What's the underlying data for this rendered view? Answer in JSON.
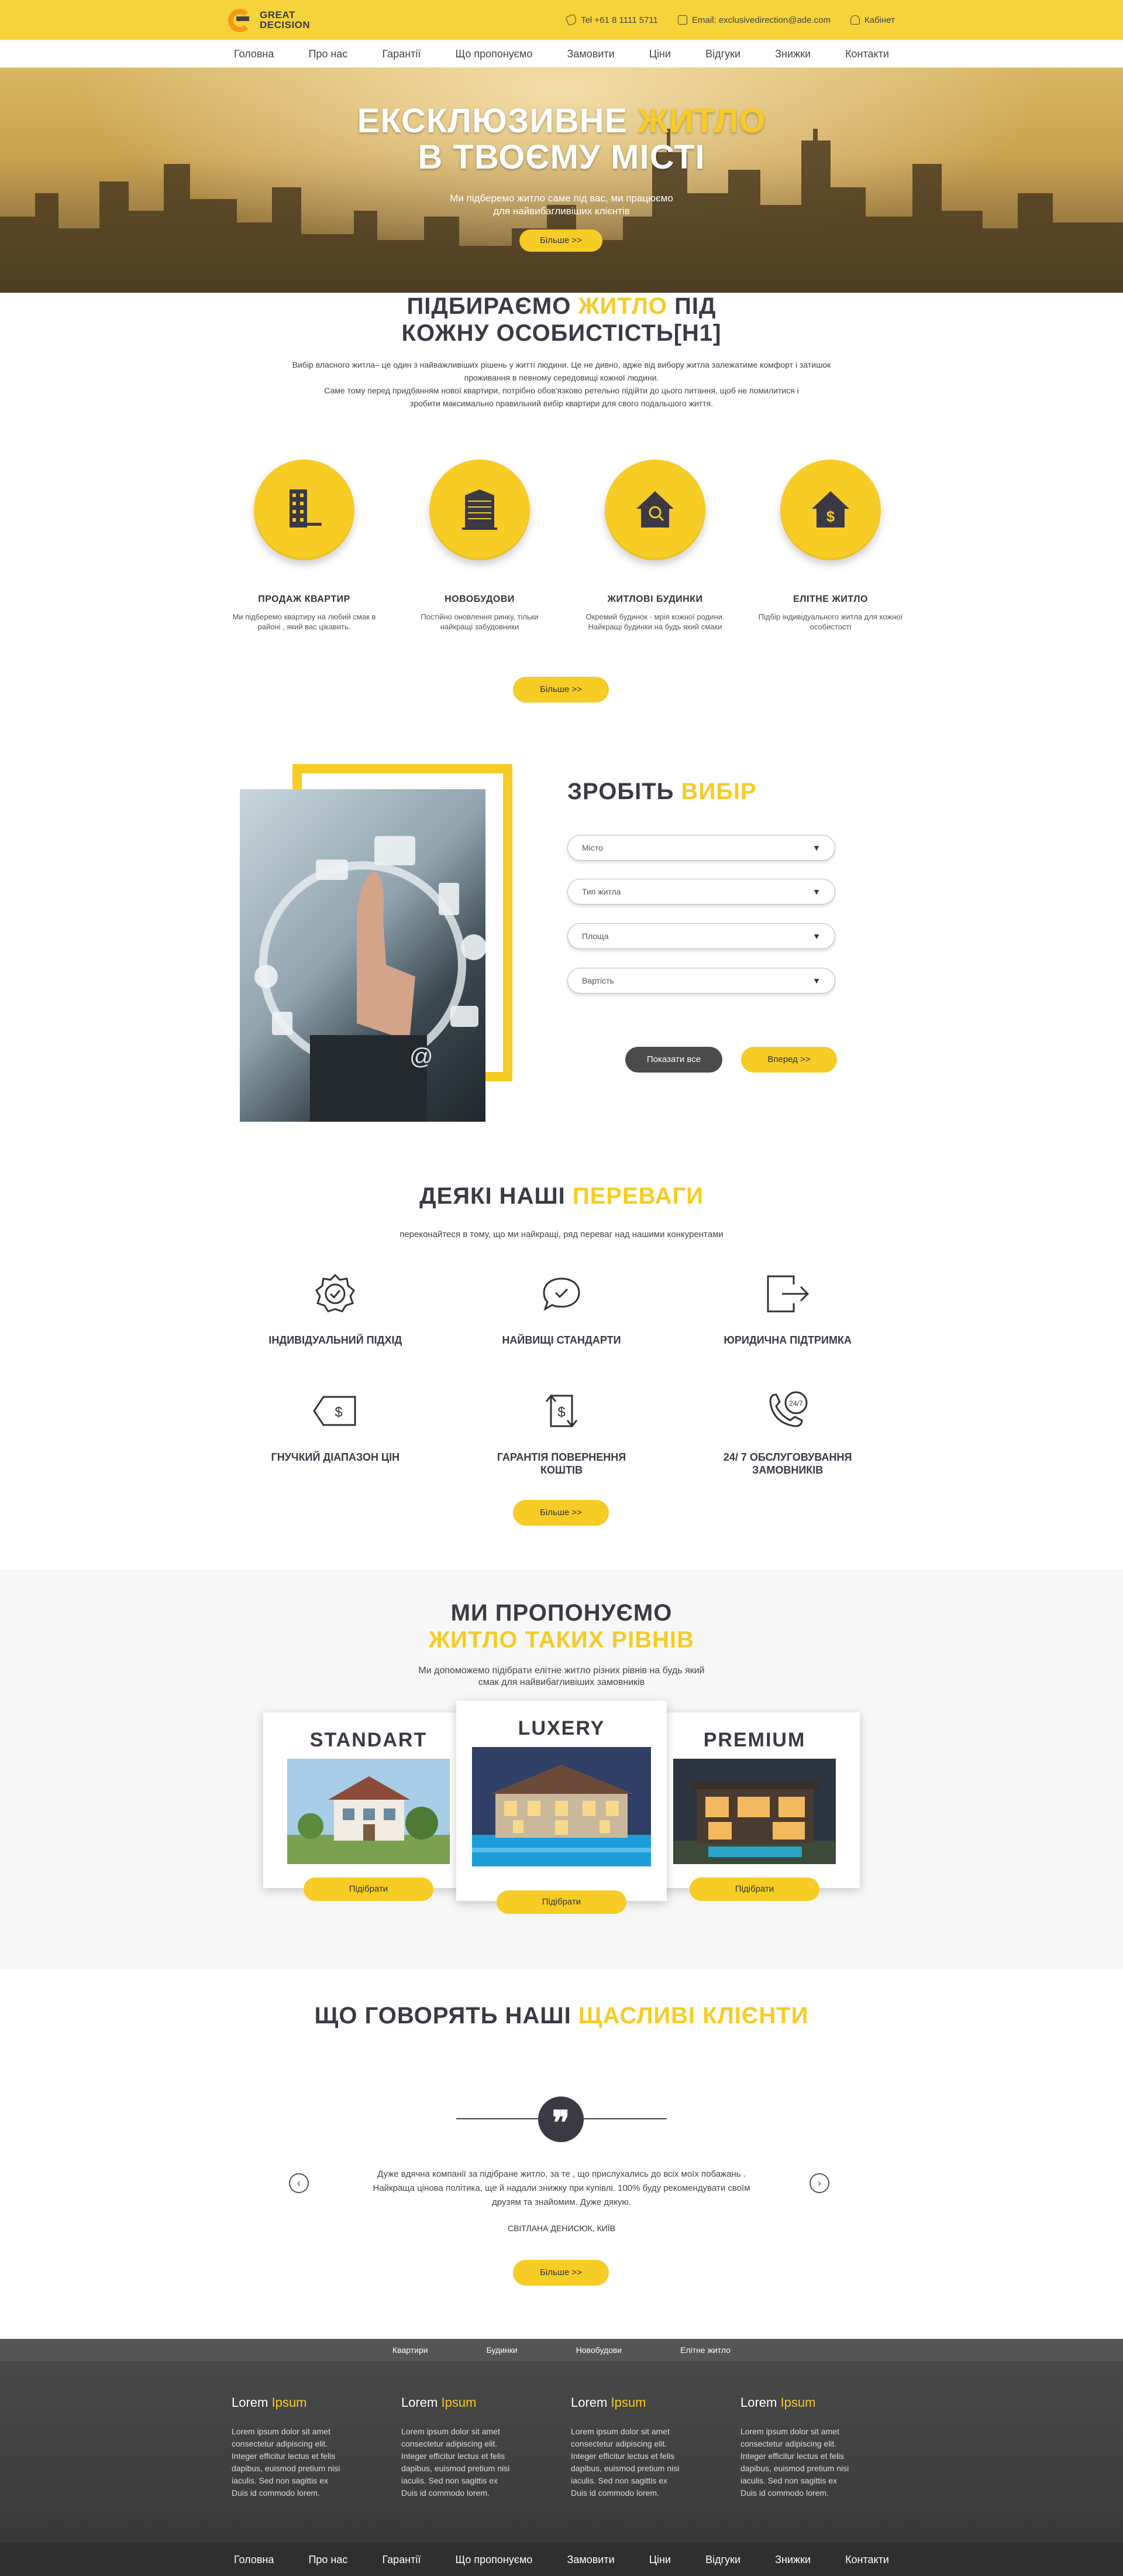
{
  "brand": {
    "logo_line1": "GREAT",
    "logo_line2": "DECISION"
  },
  "header": {
    "phone": "Tel +61 8 1111 5711",
    "email": "Email: exclusivedirection@ade.com",
    "cabinet": "Кабінет"
  },
  "nav": [
    "Головна",
    "Про нас",
    "Гарантії",
    "Що пропонуємо",
    "Замовити",
    "Ціни",
    "Відгуки",
    "Знижки",
    "Контакти"
  ],
  "hero": {
    "title_part1": "ЕКСКЛЮЗИВНЕ ",
    "title_accent": "ЖИТЛО",
    "title_line2": "В ТВОЄМУ МІСТІ",
    "subtitle_line1": "Ми підберемо житло саме під вас, ми працюємо",
    "subtitle_line2": "для найвибагливіших клієнтів",
    "button": "Більше >>"
  },
  "section_pick": {
    "title_part1": "ПІДБИРАЄМО ",
    "title_accent": "ЖИТЛО",
    "title_part2": " ПІД",
    "title_line2": "КОЖНУ ОСОБИСТІСТЬ[H1]",
    "intro_line1": "Вибір власного житла– це один з найважливіших рішень у житті людини. Це не дивно, адже від вибору житла залежатиме комфорт і затишок",
    "intro_line2": "проживання в певному середовищі кожної людини.",
    "intro_line3": "Саме тому перед придбанням нової квартири, потрібно обов'язково ретельно підійти до цього питання, щоб не помилитися і",
    "intro_line4": "зробити максимально правильний вибір квартири для свого подальшого життя.",
    "categories": [
      {
        "title": "ПРОДАЖ КВАРТИР",
        "text": "Ми підберемо квартиру на любий смак в районі , який вас цікавить.",
        "icon": "apartment-building-icon"
      },
      {
        "title": "НОВОБУДОВИ",
        "text": "Постійно оновлення ринку, тільки найкращі забудовники",
        "icon": "new-building-icon"
      },
      {
        "title": "ЖИТЛОВІ БУДИНКИ",
        "text": "Окремий будинок - мрія кожної родини. Найкращі будинки на будь який смаки",
        "icon": "house-search-icon"
      },
      {
        "title": "ЕЛІТНЕ ЖИТЛО",
        "text": "Підбір індивідуального житла для кожної особистості",
        "icon": "house-dollar-icon"
      }
    ],
    "button": "Більше >>"
  },
  "choice": {
    "title_part1": "ЗРОБІТЬ ",
    "title_accent": "ВИБІР",
    "selects": [
      "Місто",
      "Тип житла",
      "Площа",
      "Вартість"
    ],
    "show_all": "Показати все",
    "next": "Вперед >>"
  },
  "advantages": {
    "title_part1": "ДЕЯКІ НАШІ ",
    "title_accent": "ПЕРЕВАГИ",
    "subtitle": "переконайтеся в тому, що ми найкращі, ряд переваг над нашими конкурентами",
    "items": [
      {
        "title": "ІНДИВІДУАЛЬНИЙ ПІДХІД",
        "icon": "badge-check-icon"
      },
      {
        "title": "НАЙВИЩІ СТАНДАРТИ",
        "icon": "chat-check-icon"
      },
      {
        "title": "ЮРИДИЧНА ПІДТРИМКА",
        "icon": "exit-arrow-icon"
      },
      {
        "title": "ГНУЧКИЙ ДІАПАЗОН ЦІН",
        "icon": "price-tag-icon"
      },
      {
        "title_line1": "ГАРАНТІЯ ПОВЕРНЕННЯ",
        "title_line2": "КОШТІВ",
        "icon": "money-return-icon"
      },
      {
        "title_line1": "24/ 7 ОБСЛУГОВУВАННЯ",
        "title_line2": "ЗАМОВНИКІВ",
        "icon": "phone-24-7-icon"
      }
    ],
    "button": "Більше >>"
  },
  "levels": {
    "title_line1": "МИ ПРОПОНУЄМО",
    "title_line2": "ЖИТЛО ТАКИХ РІВНІВ",
    "subtitle_line1": "Ми допоможемо підібрати елітне житло різних рівнів на будь який",
    "subtitle_line2": "смак для найвибагливіших замовників",
    "cards": [
      {
        "title": "STANDART",
        "button": "Підібрати"
      },
      {
        "title": "LUXERY",
        "button": "Підібрати"
      },
      {
        "title": "PREMIUM",
        "button": "Підібрати"
      }
    ]
  },
  "testimonials": {
    "title_part1": "ЩО ГОВОРЯТЬ НАШІ ",
    "title_accent": "ЩАСЛИВІ КЛІЄНТИ",
    "quote_mark": "❞",
    "text_line1": "Дуже вдячна компанії за підібране житло, за те , що прислухались до всіх моїх побажань .",
    "text_line2": "Найкраща цінова політика, ще й надали  знижку при купівлі. 100% буду рекомендувати своїм",
    "text_line3": "друзям та знайомим. Дуже дякую.",
    "author": "СВІТЛАНА ДЕНИСЮК, КИЇВ",
    "prev": "‹",
    "next": "›",
    "button": "Більше >>"
  },
  "footer": {
    "categories": [
      "Квартири",
      "Будинки",
      "Новобудови",
      "Елітне житло"
    ],
    "columns": [
      {
        "title_part1": "Lorem ",
        "title_accent": "Ipsum",
        "text": "Lorem ipsum dolor sit amet consectetur adipiscing elit. Integer efficitur lectus et felis dapibus, euismod pretium nisi iaculis. Sed non sagittis ex Duis id commodo lorem."
      },
      {
        "title_part1": "Lorem ",
        "title_accent": "Ipsum",
        "text": "Lorem ipsum dolor sit amet consectetur adipiscing elit. Integer efficitur lectus et felis dapibus, euismod pretium nisi iaculis. Sed non sagittis ex Duis id commodo lorem."
      },
      {
        "title_part1": "Lorem ",
        "title_accent": "Ipsum",
        "text": "Lorem ipsum dolor sit amet consectetur adipiscing elit. Integer efficitur lectus et felis dapibus, euismod pretium nisi iaculis. Sed non sagittis ex Duis id commodo lorem."
      },
      {
        "title_part1": "Lorem ",
        "title_accent": "Ipsum",
        "text": "Lorem ipsum dolor sit amet consectetur adipiscing elit. Integer efficitur lectus et felis dapibus, euismod pretium nisi iaculis. Sed non sagittis ex Duis id commodo lorem."
      }
    ],
    "nav": [
      "Головна",
      "Про нас",
      "Гарантії",
      "Що пропонуємо",
      "Замовити",
      "Ціни",
      "Відгуки",
      "Знижки",
      "Контакти"
    ]
  },
  "colors": {
    "accent": "#f6cc25",
    "dark": "#3b3944",
    "footer": "#3f3f3f"
  }
}
